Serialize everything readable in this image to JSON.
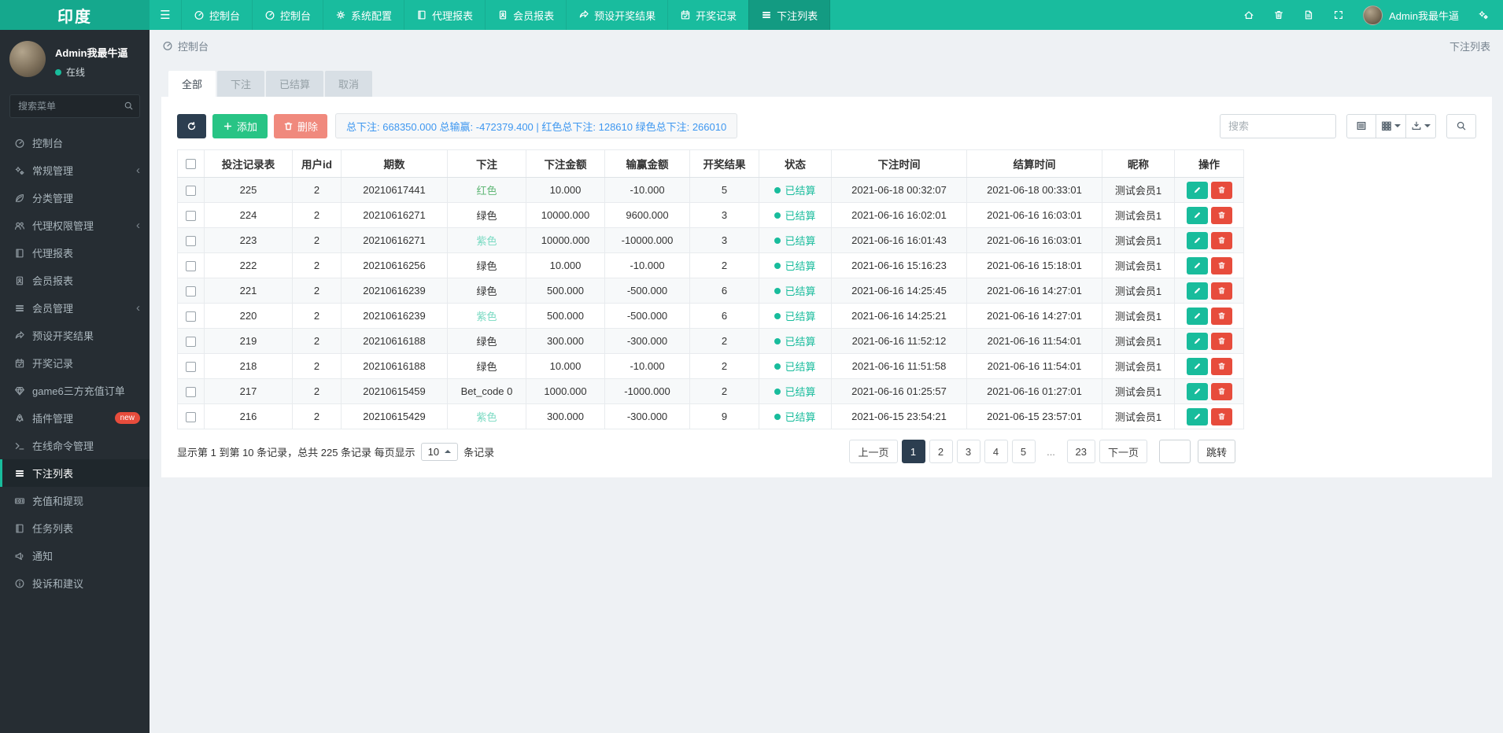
{
  "brand": "印度",
  "navbar": {
    "items": [
      {
        "label": "控制台",
        "icon": "tachometer",
        "active": false
      },
      {
        "label": "控制台",
        "icon": "tachometer",
        "active": false
      },
      {
        "label": "系统配置",
        "icon": "gear",
        "active": false
      },
      {
        "label": "代理报表",
        "icon": "book",
        "active": false
      },
      {
        "label": "会员报表",
        "icon": "id-card",
        "active": false
      },
      {
        "label": "预设开奖结果",
        "icon": "share",
        "active": false
      },
      {
        "label": "开奖记录",
        "icon": "calendar",
        "active": false
      },
      {
        "label": "下注列表",
        "icon": "list",
        "active": true
      }
    ],
    "right_icons": [
      "home-icon",
      "trash-icon",
      "log-icon",
      "expand-icon"
    ],
    "user_name": "Admin我最牛逼",
    "settings_icon": "gears-icon"
  },
  "sidebar": {
    "user": {
      "name": "Admin我最牛逼",
      "status": "在线"
    },
    "search_placeholder": "搜索菜单",
    "items": [
      {
        "label": "控制台",
        "icon": "tachometer"
      },
      {
        "label": "常规管理",
        "icon": "gears",
        "chevron": true
      },
      {
        "label": "分类管理",
        "icon": "leaf"
      },
      {
        "label": "代理权限管理",
        "icon": "users",
        "chevron": true
      },
      {
        "label": "代理报表",
        "icon": "book"
      },
      {
        "label": "会员报表",
        "icon": "id-card"
      },
      {
        "label": "会员管理",
        "icon": "list",
        "chevron": true
      },
      {
        "label": "预设开奖结果",
        "icon": "share"
      },
      {
        "label": "开奖记录",
        "icon": "calendar"
      },
      {
        "label": "game6三方充值订单",
        "icon": "gem"
      },
      {
        "label": "插件管理",
        "icon": "rocket",
        "badge": "new"
      },
      {
        "label": "在线命令管理",
        "icon": "terminal"
      },
      {
        "label": "下注列表",
        "icon": "list",
        "active": true
      },
      {
        "label": "充值和提现",
        "icon": "money"
      },
      {
        "label": "任务列表",
        "icon": "book"
      },
      {
        "label": "通知",
        "icon": "bullhorn"
      },
      {
        "label": "投诉和建议",
        "icon": "info"
      }
    ]
  },
  "breadcrumb": {
    "left": "控制台",
    "right": "下注列表"
  },
  "tabs": [
    {
      "label": "全部",
      "active": true
    },
    {
      "label": "下注",
      "active": false
    },
    {
      "label": "已结算",
      "active": false
    },
    {
      "label": "取消",
      "active": false
    }
  ],
  "toolbar": {
    "add_label": "添加",
    "delete_label": "删除",
    "summary": "总下注: 668350.000 总输赢: -472379.400 | 红色总下注: 128610 绿色总下注: 266010",
    "search_placeholder": "搜索"
  },
  "table": {
    "columns": [
      "投注记录表",
      "用户id",
      "期数",
      "下注",
      "下注金额",
      "输赢金额",
      "开奖结果",
      "状态",
      "下注时间",
      "结算时间",
      "昵称",
      "操作"
    ],
    "rows": [
      {
        "id": "225",
        "uid": "2",
        "issue": "20210617441",
        "bet": "红色",
        "bet_color": "green",
        "amount": "10.000",
        "winlose": "-10.000",
        "result": "5",
        "status": "已结算",
        "bet_time": "2021-06-18 00:32:07",
        "settle_time": "2021-06-18 00:33:01",
        "nick": "测试会员1"
      },
      {
        "id": "224",
        "uid": "2",
        "issue": "20210616271",
        "bet": "绿色",
        "bet_color": "dark",
        "amount": "10000.000",
        "winlose": "9600.000",
        "result": "3",
        "status": "已结算",
        "bet_time": "2021-06-16 16:02:01",
        "settle_time": "2021-06-16 16:03:01",
        "nick": "测试会员1"
      },
      {
        "id": "223",
        "uid": "2",
        "issue": "20210616271",
        "bet": "紫色",
        "bet_color": "teal",
        "amount": "10000.000",
        "winlose": "-10000.000",
        "result": "3",
        "status": "已结算",
        "bet_time": "2021-06-16 16:01:43",
        "settle_time": "2021-06-16 16:03:01",
        "nick": "测试会员1"
      },
      {
        "id": "222",
        "uid": "2",
        "issue": "20210616256",
        "bet": "绿色",
        "bet_color": "dark",
        "amount": "10.000",
        "winlose": "-10.000",
        "result": "2",
        "status": "已结算",
        "bet_time": "2021-06-16 15:16:23",
        "settle_time": "2021-06-16 15:18:01",
        "nick": "测试会员1"
      },
      {
        "id": "221",
        "uid": "2",
        "issue": "20210616239",
        "bet": "绿色",
        "bet_color": "dark",
        "amount": "500.000",
        "winlose": "-500.000",
        "result": "6",
        "status": "已结算",
        "bet_time": "2021-06-16 14:25:45",
        "settle_time": "2021-06-16 14:27:01",
        "nick": "测试会员1"
      },
      {
        "id": "220",
        "uid": "2",
        "issue": "20210616239",
        "bet": "紫色",
        "bet_color": "teal",
        "amount": "500.000",
        "winlose": "-500.000",
        "result": "6",
        "status": "已结算",
        "bet_time": "2021-06-16 14:25:21",
        "settle_time": "2021-06-16 14:27:01",
        "nick": "测试会员1"
      },
      {
        "id": "219",
        "uid": "2",
        "issue": "20210616188",
        "bet": "绿色",
        "bet_color": "dark",
        "amount": "300.000",
        "winlose": "-300.000",
        "result": "2",
        "status": "已结算",
        "bet_time": "2021-06-16 11:52:12",
        "settle_time": "2021-06-16 11:54:01",
        "nick": "测试会员1"
      },
      {
        "id": "218",
        "uid": "2",
        "issue": "20210616188",
        "bet": "绿色",
        "bet_color": "dark",
        "amount": "10.000",
        "winlose": "-10.000",
        "result": "2",
        "status": "已结算",
        "bet_time": "2021-06-16 11:51:58",
        "settle_time": "2021-06-16 11:54:01",
        "nick": "测试会员1"
      },
      {
        "id": "217",
        "uid": "2",
        "issue": "20210615459",
        "bet": "Bet_code 0",
        "bet_color": "dark",
        "amount": "1000.000",
        "winlose": "-1000.000",
        "result": "2",
        "status": "已结算",
        "bet_time": "2021-06-16 01:25:57",
        "settle_time": "2021-06-16 01:27:01",
        "nick": "测试会员1"
      },
      {
        "id": "216",
        "uid": "2",
        "issue": "20210615429",
        "bet": "紫色",
        "bet_color": "teal",
        "amount": "300.000",
        "winlose": "-300.000",
        "result": "9",
        "status": "已结算",
        "bet_time": "2021-06-15 23:54:21",
        "settle_time": "2021-06-15 23:57:01",
        "nick": "测试会员1"
      }
    ]
  },
  "footer": {
    "info": "显示第 1 到第 10 条记录，总共 225 条记录 每页显示",
    "per_page": "10",
    "info_suffix": "条记录"
  },
  "pagination": {
    "prev": "上一页",
    "next": "下一页",
    "pages": [
      "1",
      "2",
      "3",
      "4",
      "5",
      "...",
      "23"
    ],
    "active": "1",
    "jump_label": "跳转"
  },
  "colors": {
    "navbar": "#19bc9e",
    "navbar_active": "#139b82",
    "sidebar": "#262d33",
    "accent": "#18bc9c",
    "primary_btn": "#2c3e50",
    "add_btn": "#28c485",
    "delete_btn": "#f0897d",
    "danger": "#e74c3c",
    "summary_text": "#3e97f0",
    "bet_green": "#62b878",
    "bet_teal": "#79dac2"
  }
}
